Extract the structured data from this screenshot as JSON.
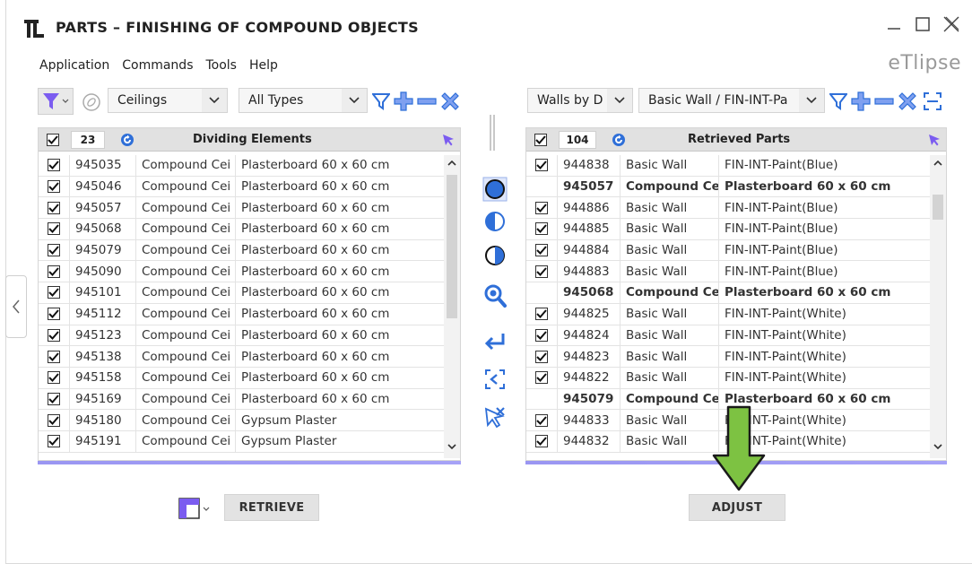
{
  "window": {
    "title": "PARTS – FINISHING OF COMPOUND OBJECTS",
    "brand": "eTlipse",
    "controls": [
      "minimize-icon",
      "maximize-icon",
      "close-icon"
    ]
  },
  "menu": [
    "Application",
    "Commands",
    "Tools",
    "Help"
  ],
  "left_toolbar": {
    "category_select": "Ceilings",
    "type_select": "All Types"
  },
  "right_toolbar": {
    "category_select": "Walls by D",
    "type_select": "Basic Wall / FIN-INT-Pa"
  },
  "left_panel": {
    "header_title": "Dividing Elements",
    "count": "23",
    "rows": [
      {
        "id": "945035",
        "category": "Compound Cei",
        "name": "Plasterboard 60 x 60 cm",
        "checked": true
      },
      {
        "id": "945046",
        "category": "Compound Cei",
        "name": "Plasterboard 60 x 60 cm",
        "checked": true
      },
      {
        "id": "945057",
        "category": "Compound Cei",
        "name": "Plasterboard 60 x 60 cm",
        "checked": true
      },
      {
        "id": "945068",
        "category": "Compound Cei",
        "name": "Plasterboard 60 x 60 cm",
        "checked": true
      },
      {
        "id": "945079",
        "category": "Compound Cei",
        "name": "Plasterboard 60 x 60 cm",
        "checked": true
      },
      {
        "id": "945090",
        "category": "Compound Cei",
        "name": "Plasterboard 60 x 60 cm",
        "checked": true
      },
      {
        "id": "945101",
        "category": "Compound Cei",
        "name": "Plasterboard 60 x 60 cm",
        "checked": true
      },
      {
        "id": "945112",
        "category": "Compound Cei",
        "name": "Plasterboard 60 x 60 cm",
        "checked": true
      },
      {
        "id": "945123",
        "category": "Compound Cei",
        "name": "Plasterboard 60 x 60 cm",
        "checked": true
      },
      {
        "id": "945138",
        "category": "Compound Cei",
        "name": "Plasterboard 60 x 60 cm",
        "checked": true
      },
      {
        "id": "945158",
        "category": "Compound Cei",
        "name": "Plasterboard 60 x 60 cm",
        "checked": true
      },
      {
        "id": "945169",
        "category": "Compound Cei",
        "name": "Plasterboard 60 x 60 cm",
        "checked": true
      },
      {
        "id": "945180",
        "category": "Compound Cei",
        "name": "Gypsum Plaster",
        "checked": true
      },
      {
        "id": "945191",
        "category": "Compound Cei",
        "name": "Gypsum Plaster",
        "checked": true
      }
    ]
  },
  "right_panel": {
    "header_title": "Retrieved Parts",
    "count": "104",
    "rows": [
      {
        "id": "944838",
        "category": "Basic Wall",
        "name": "FIN-INT-Paint(Blue)",
        "checked": true,
        "group": false
      },
      {
        "id": "945057",
        "category": "Compound Cei",
        "name": "Plasterboard 60 x 60 cm",
        "checked": false,
        "group": true
      },
      {
        "id": "944886",
        "category": "Basic Wall",
        "name": "FIN-INT-Paint(Blue)",
        "checked": true,
        "group": false
      },
      {
        "id": "944885",
        "category": "Basic Wall",
        "name": "FIN-INT-Paint(Blue)",
        "checked": true,
        "group": false
      },
      {
        "id": "944884",
        "category": "Basic Wall",
        "name": "FIN-INT-Paint(Blue)",
        "checked": true,
        "group": false
      },
      {
        "id": "944883",
        "category": "Basic Wall",
        "name": "FIN-INT-Paint(Blue)",
        "checked": true,
        "group": false
      },
      {
        "id": "945068",
        "category": "Compound Cei",
        "name": "Plasterboard 60 x 60 cm",
        "checked": false,
        "group": true
      },
      {
        "id": "944825",
        "category": "Basic Wall",
        "name": "FIN-INT-Paint(White)",
        "checked": true,
        "group": false
      },
      {
        "id": "944824",
        "category": "Basic Wall",
        "name": "FIN-INT-Paint(White)",
        "checked": true,
        "group": false
      },
      {
        "id": "944823",
        "category": "Basic Wall",
        "name": "FIN-INT-Paint(White)",
        "checked": true,
        "group": false
      },
      {
        "id": "944822",
        "category": "Basic Wall",
        "name": "FIN-INT-Paint(White)",
        "checked": true,
        "group": false
      },
      {
        "id": "945079",
        "category": "Compound Cei",
        "name": "Plasterboard 60 x 60 cm",
        "checked": false,
        "group": true
      },
      {
        "id": "944833",
        "category": "Basic Wall",
        "name": "FIN-INT-Paint(White)",
        "checked": true,
        "group": false
      },
      {
        "id": "944832",
        "category": "Basic Wall",
        "name": "FIN-INT-Paint(White)",
        "checked": true,
        "group": false
      }
    ]
  },
  "buttons": {
    "retrieve": "RETRIEVE",
    "adjust": "ADJUST"
  },
  "colors": {
    "accent_purple": "#7b5cf0",
    "accent_blue": "#2f6fd8",
    "highlight_arrow": "#7dc242",
    "header_bg": "#e1e1e1"
  }
}
